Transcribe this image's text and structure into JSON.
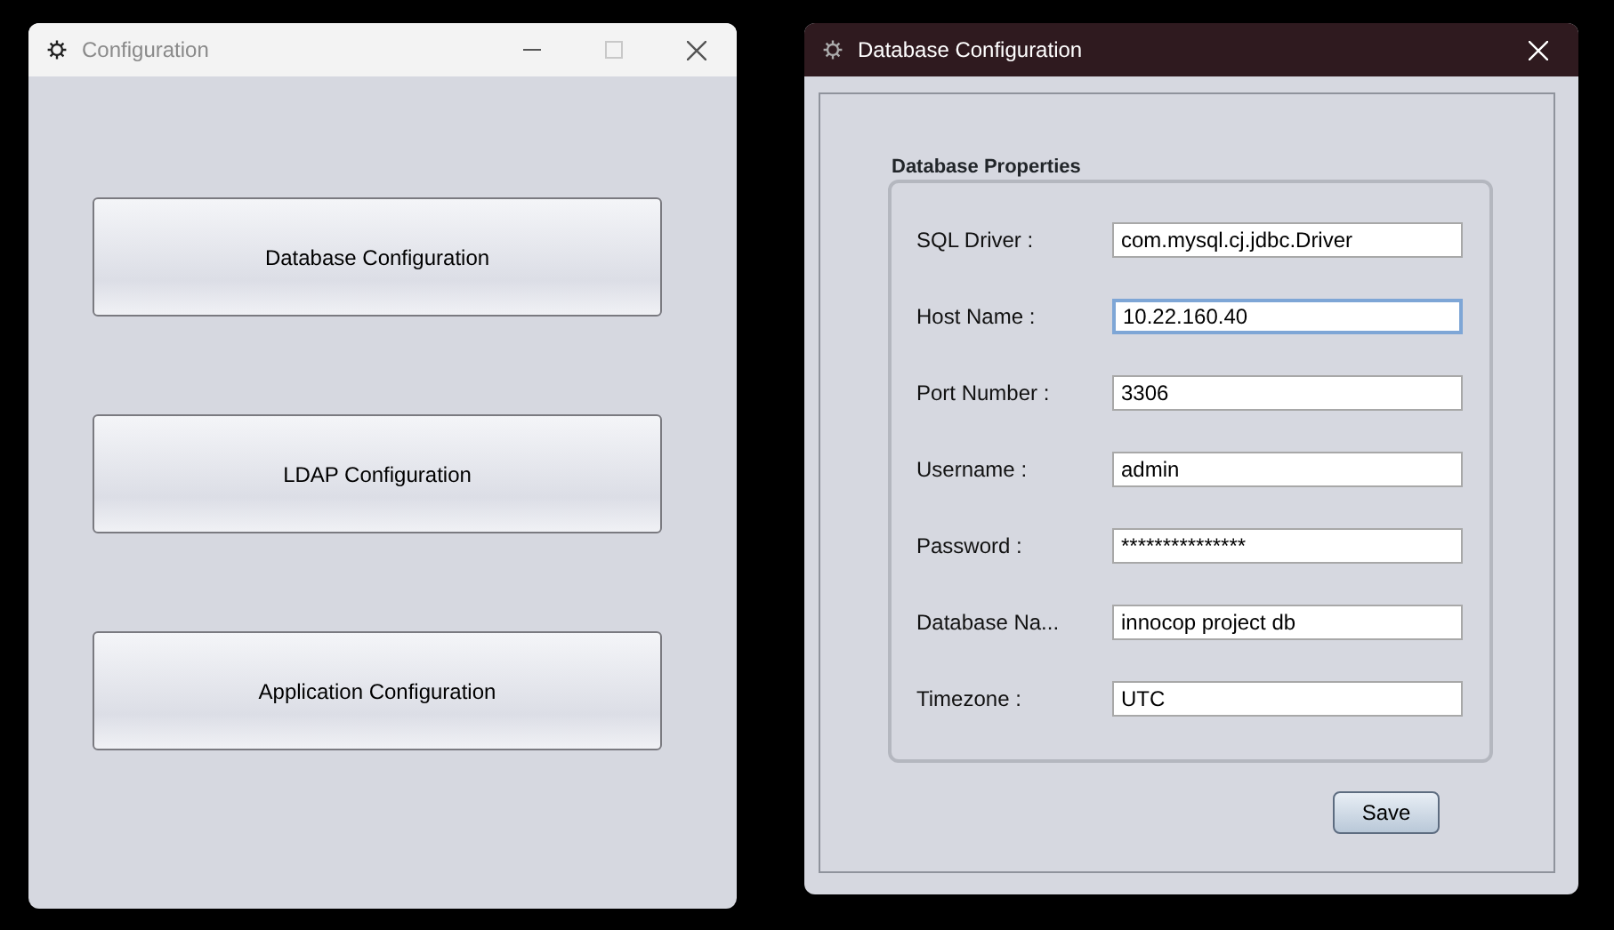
{
  "windows": [
    {
      "title": "Configuration",
      "dark": false,
      "controls": [
        {
          "kind": "minimize"
        },
        {
          "kind": "maximize"
        },
        {
          "kind": "close"
        }
      ],
      "buttons": [
        "Database Configuration",
        "LDAP Configuration",
        "Application Configuration"
      ]
    },
    {
      "title": "Database Configuration",
      "dark": true,
      "controls": [
        {
          "kind": "close"
        }
      ],
      "group": {
        "title": "Database Properties",
        "fields": [
          {
            "label": "SQL Driver :",
            "value": "com.mysql.cj.jdbc.Driver",
            "focused": false
          },
          {
            "label": "Host Name :",
            "value": "10.22.160.40",
            "focused": true
          },
          {
            "label": "Port Number :",
            "value": "3306",
            "focused": false
          },
          {
            "label": "Username :",
            "value": "admin",
            "focused": false
          },
          {
            "label": "Password :",
            "value": "***************",
            "focused": false
          },
          {
            "label": "Database Na...",
            "value": "innocop project db",
            "focused": false
          },
          {
            "label": "Timezone :",
            "value": "UTC",
            "focused": false
          }
        ]
      },
      "buttons": [
        "Save"
      ]
    }
  ]
}
